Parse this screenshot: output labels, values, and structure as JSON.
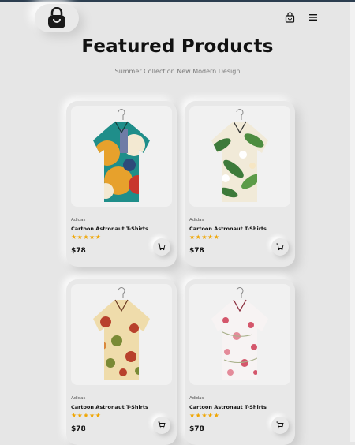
{
  "header": {
    "logo_icon": "shopping-bag-icon",
    "cart_icon": "cart-bag-icon",
    "menu_icon": "hamburger-menu-icon"
  },
  "hero": {
    "title": "Featured Products",
    "subtitle": "Summer Collection New Modern Design"
  },
  "products": [
    {
      "brand": "Adidas",
      "name": "Cartoon Astronaut T-Shirts",
      "stars": "★★★★★",
      "rating": 5,
      "price": "$78",
      "cart_icon": "cart-icon"
    },
    {
      "brand": "Adidas",
      "name": "Cartoon Astronaut T-Shirts",
      "stars": "★★★★★",
      "rating": 5,
      "price": "$78",
      "cart_icon": "cart-icon"
    },
    {
      "brand": "Adidas",
      "name": "Cartoon Astronaut T-Shirts",
      "stars": "★★★★★",
      "rating": 5,
      "price": "$78",
      "cart_icon": "cart-icon"
    },
    {
      "brand": "Adidas",
      "name": "Cartoon Astronaut T-Shirts",
      "stars": "★★★★★",
      "rating": 5,
      "price": "$78",
      "cart_icon": "cart-icon"
    }
  ],
  "colors": {
    "background": "#e6e6e6",
    "star": "#f0a500",
    "accent": "#2c3e50"
  }
}
